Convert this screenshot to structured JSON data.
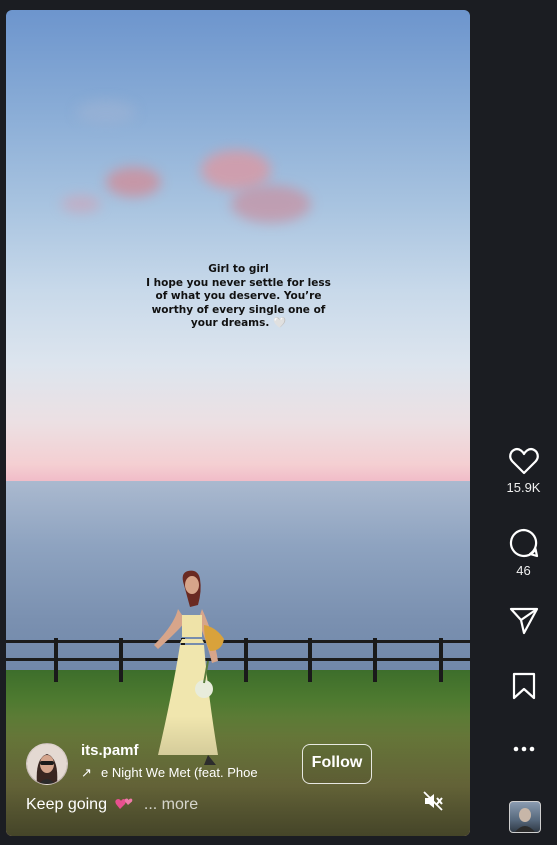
{
  "overlay_text": {
    "lines": [
      "Girl to girl",
      "I hope you never settle for less",
      "of what you deserve. You’re",
      "worthy of every single one of",
      "your dreams. 🤍"
    ]
  },
  "post": {
    "username": "its.pamf",
    "audio_arrow": "↗",
    "audio_track": "e Night We Met (feat. Phoe",
    "follow_label": "Follow",
    "caption": "Keep going",
    "caption_emoji": "💕",
    "more_label": "... more"
  },
  "actions": {
    "likes": "15.9K",
    "comments": "46"
  },
  "icons": {
    "like": "heart-icon",
    "comment": "comment-bubble-icon",
    "share": "paper-plane-icon",
    "save": "bookmark-icon",
    "more": "more-dots-icon",
    "mute": "speaker-muted-icon"
  },
  "colors": {
    "background": "#1b1d22",
    "text": "#ffffff",
    "caption_heart": "#e8508f"
  }
}
